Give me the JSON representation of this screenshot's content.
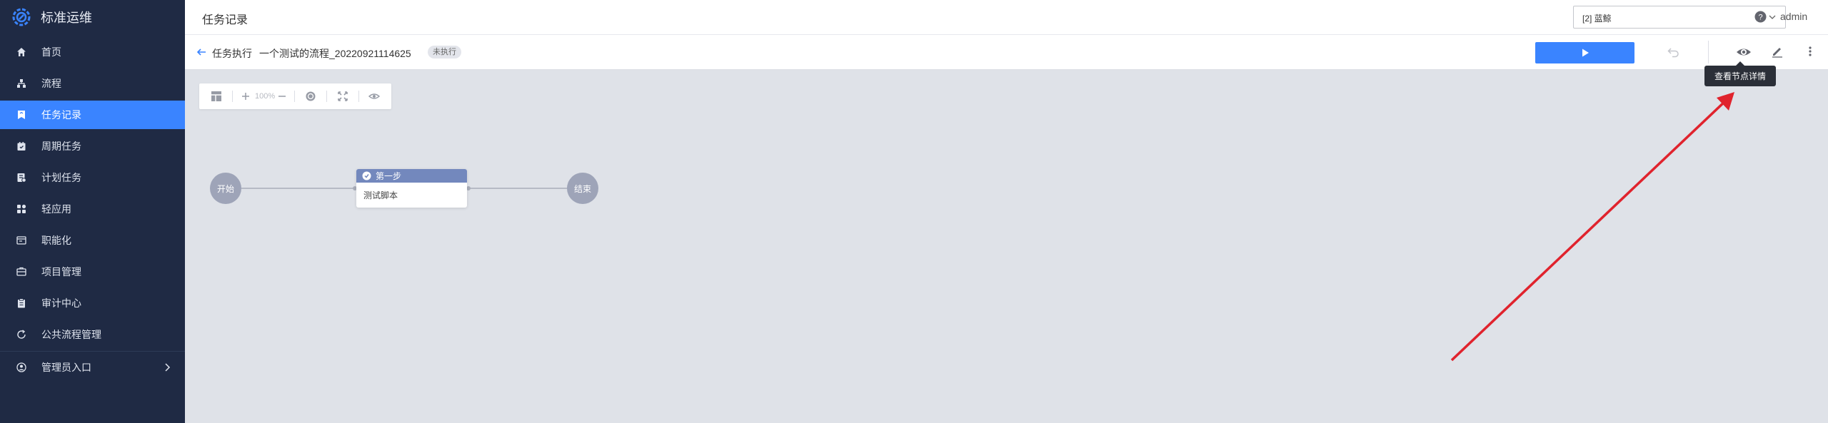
{
  "app": {
    "name": "标准运维"
  },
  "sidebar": {
    "items": [
      {
        "label": "首页",
        "icon": "home-icon"
      },
      {
        "label": "流程",
        "icon": "flow-icon"
      },
      {
        "label": "任务记录",
        "icon": "bookmark-icon",
        "active": true
      },
      {
        "label": "周期任务",
        "icon": "calendar-icon"
      },
      {
        "label": "计划任务",
        "icon": "plan-icon"
      },
      {
        "label": "轻应用",
        "icon": "apps-icon"
      },
      {
        "label": "职能化",
        "icon": "function-icon"
      },
      {
        "label": "项目管理",
        "icon": "project-icon"
      },
      {
        "label": "审计中心",
        "icon": "audit-icon"
      },
      {
        "label": "公共流程管理",
        "icon": "refresh-icon"
      }
    ],
    "admin": {
      "label": "管理员入口",
      "icon": "user-icon"
    }
  },
  "header": {
    "title": "任务记录",
    "project_select": "[2] 蓝鲸",
    "user": "admin"
  },
  "task_bar": {
    "crumb": "任务执行",
    "flow_name": "一个测试的流程_20220921114625",
    "status": "未执行"
  },
  "canvas_tools": {
    "zoom": "100%"
  },
  "tooltip": "查看节点详情",
  "flow": {
    "start": "开始",
    "task_title": "第一步",
    "task_body": "测试脚本",
    "end": "结束"
  },
  "colors": {
    "accent": "#3a84ff",
    "sidebar": "#1f2a44",
    "node": "#9ea4b8",
    "task_header": "#7388bd",
    "annotation": "#e0232d"
  }
}
